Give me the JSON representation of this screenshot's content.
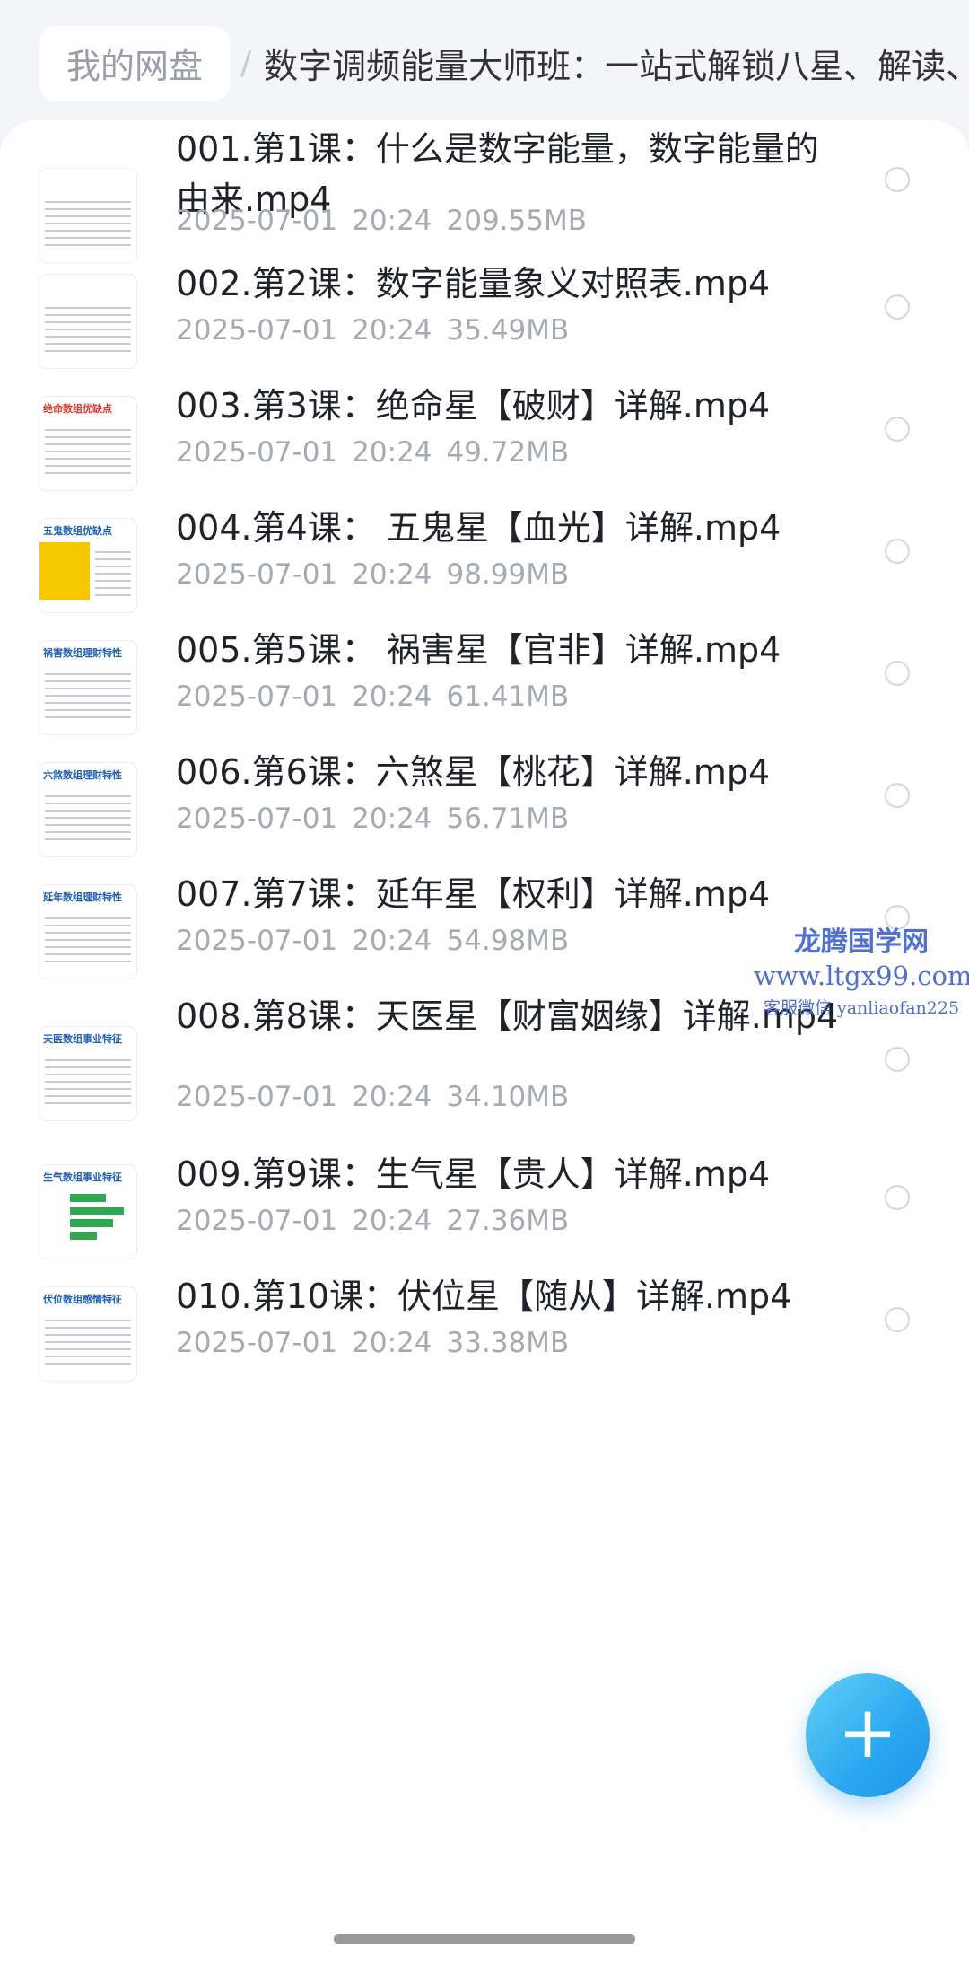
{
  "breadcrumb": {
    "root": "我的网盘",
    "separator": "/",
    "current": "数字调频能量大师班：一站式解锁八星、解读、"
  },
  "files": [
    {
      "name": "001.第1课：什么是数字能量，数字能量的由来.mp4",
      "date": "2025-07-01",
      "time": "20:24",
      "size": "209.55MB",
      "thumb_title": "",
      "thumb_color": "#888888"
    },
    {
      "name": "002.第2课：数字能量象义对照表.mp4",
      "date": "2025-07-01",
      "time": "20:24",
      "size": "35.49MB",
      "thumb_title": "",
      "thumb_color": "#444444"
    },
    {
      "name": "003.第3课：绝命星【破财】详解.mp4",
      "date": "2025-07-01",
      "time": "20:24",
      "size": "49.72MB",
      "thumb_title": "绝命数组优缺点",
      "thumb_color": "#1e5fb4"
    },
    {
      "name": "004.第4课： 五鬼星【血光】详解.mp4",
      "date": "2025-07-01",
      "time": "20:24",
      "size": "98.99MB",
      "thumb_title": "五鬼数组优缺点",
      "thumb_color": "#1e5fb4"
    },
    {
      "name": "005.第5课： 祸害星【官非】详解.mp4",
      "date": "2025-07-01",
      "time": "20:24",
      "size": "61.41MB",
      "thumb_title": "祸害数组理财特性",
      "thumb_color": "#1e5fb4"
    },
    {
      "name": "006.第6课：六煞星【桃花】详解.mp4",
      "date": "2025-07-01",
      "time": "20:24",
      "size": "56.71MB",
      "thumb_title": "六煞数组理财特性",
      "thumb_color": "#1e5fb4"
    },
    {
      "name": "007.第7课：延年星【权利】详解.mp4",
      "date": "2025-07-01",
      "time": "20:24",
      "size": "54.98MB",
      "thumb_title": "延年数组理财特性",
      "thumb_color": "#1e5fb4"
    },
    {
      "name": "008.第8课：天医星【财富姻缘】详解.mp4",
      "date": "2025-07-01",
      "time": "20:24",
      "size": "34.10MB",
      "thumb_title": "天医数组事业特征",
      "thumb_color": "#1e5fb4"
    },
    {
      "name": "009.第9课：生气星【贵人】详解.mp4",
      "date": "2025-07-01",
      "time": "20:24",
      "size": "27.36MB",
      "thumb_title": "生气数组事业特征",
      "thumb_color": "#1e5fb4"
    },
    {
      "name": "010.第10课：伏位星【随从】详解.mp4",
      "date": "2025-07-01",
      "time": "20:24",
      "size": "33.38MB",
      "thumb_title": "伏位数组感情特征",
      "thumb_color": "#1e5fb4"
    }
  ],
  "watermark": {
    "title": "龙腾国学网",
    "url": "www.ltgx99.com",
    "contact": "客服微信 yanliaofan225"
  },
  "fab": {
    "symbol": "+",
    "color": "#2aa7ef"
  }
}
